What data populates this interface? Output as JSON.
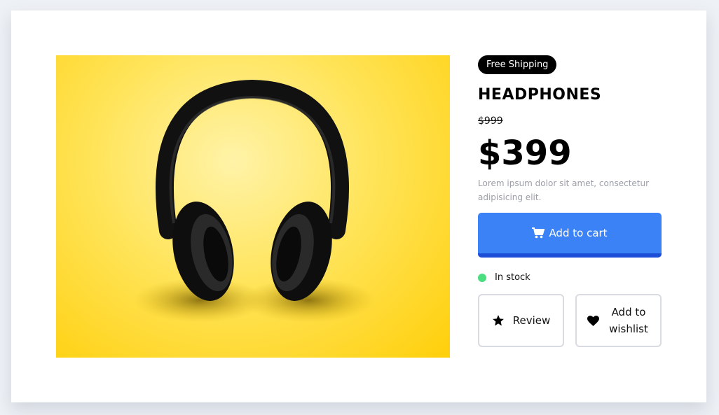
{
  "product": {
    "badge": "Free Shipping",
    "title": "HEADPHONES",
    "old_price": "$999",
    "price": "$399",
    "description": "Lorem ipsum dolor sit amet, consectetur adipisicing elit.",
    "image_alt": "headphones-photo"
  },
  "actions": {
    "add_to_cart": "Add to cart",
    "stock_status": "In stock",
    "review": "Review",
    "wishlist": "Add to wishlist"
  },
  "colors": {
    "accent": "#3b82f6",
    "accent_dark": "#1d4ed8",
    "stock": "#4ade80",
    "badge_bg": "#000000"
  },
  "icons": {
    "cart": "cart-icon",
    "review": "star-icon",
    "wishlist": "heart-icon"
  }
}
